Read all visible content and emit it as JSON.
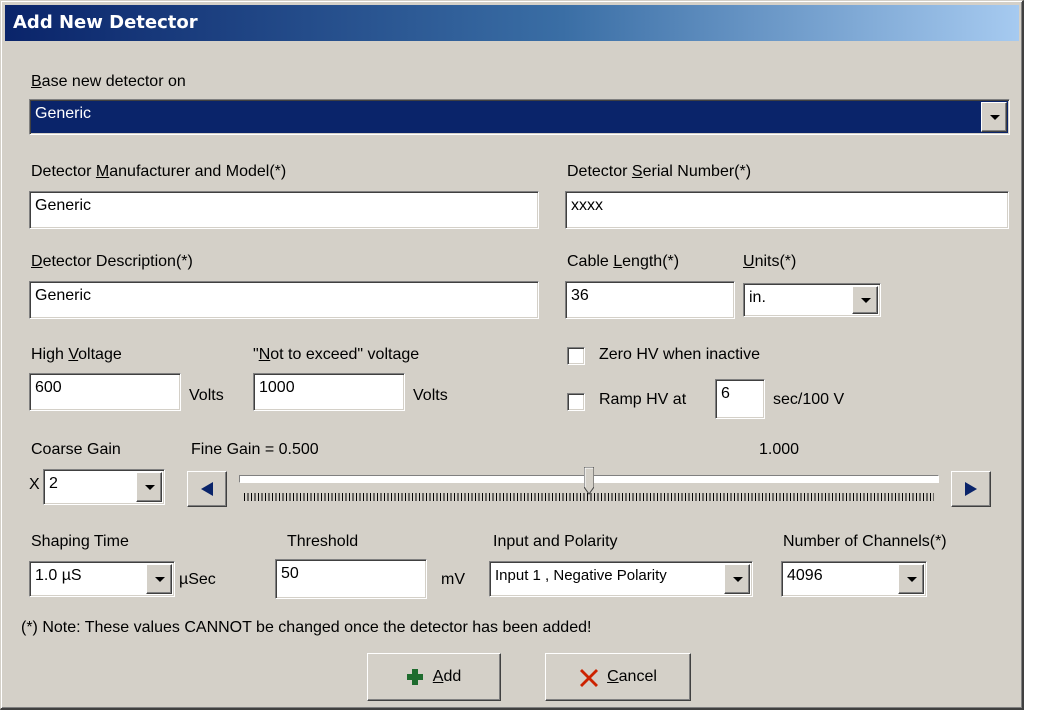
{
  "window": {
    "title": "Add New Detector"
  },
  "base": {
    "label_pre": "",
    "label_u": "B",
    "label_post": "ase new detector on",
    "value": "Generic"
  },
  "manufacturer": {
    "label_pre": "Detector ",
    "label_u": "M",
    "label_post": "anufacturer and Model(*)",
    "value": "Generic"
  },
  "serial": {
    "label_pre": "Detector ",
    "label_u": "S",
    "label_post": "erial Number(*)",
    "value": "xxxx"
  },
  "description": {
    "label_pre": "",
    "label_u": "D",
    "label_post": "etector Description(*)",
    "value": "Generic"
  },
  "cable": {
    "label_pre": "Cable ",
    "label_u": "L",
    "label_post": "ength(*)",
    "value": "36"
  },
  "units": {
    "label_pre": "",
    "label_u": "U",
    "label_post": "nits(*)",
    "value": "in."
  },
  "high_voltage": {
    "label_pre": "High ",
    "label_u": "V",
    "label_post": "oltage",
    "value": "600",
    "unit": "Volts"
  },
  "not_exceed": {
    "label_pre": "\"",
    "label_u": "N",
    "label_post": "ot to exceed\" voltage",
    "value": "1000",
    "unit": "Volts"
  },
  "zero_hv": {
    "label": "Zero HV when inactive",
    "checked": false
  },
  "ramp_hv": {
    "label_pre": "Ramp HV at",
    "value": "6",
    "label_post": "sec/100 V",
    "checked": false
  },
  "coarse_gain": {
    "label": "Coarse Gain",
    "prefix": "X",
    "value": "2"
  },
  "fine_gain": {
    "label": "Fine Gain = 0.500",
    "max_label": "1.000",
    "position": 0.5
  },
  "shaping": {
    "label": "Shaping Time",
    "value": "1.0 µS",
    "unit": "µSec"
  },
  "threshold": {
    "label": "Threshold",
    "value": "50",
    "unit": "mV"
  },
  "input_polarity": {
    "label": "Input and Polarity",
    "value": "Input 1 , Negative Polarity"
  },
  "channels": {
    "label": "Number of Channels(*)",
    "value": "4096"
  },
  "note": "(*) Note:  These values CANNOT be changed once the detector has been added!",
  "buttons": {
    "add_pre": "",
    "add_u": "A",
    "add_post": "dd",
    "cancel_pre": "",
    "cancel_u": "C",
    "cancel_post": "ancel"
  },
  "colors": {
    "title_start": "#0a246a",
    "title_end": "#a6caf0",
    "face": "#d4d0c8",
    "add_icon": "#1e6b2e",
    "cancel_icon": "#cc2200"
  }
}
